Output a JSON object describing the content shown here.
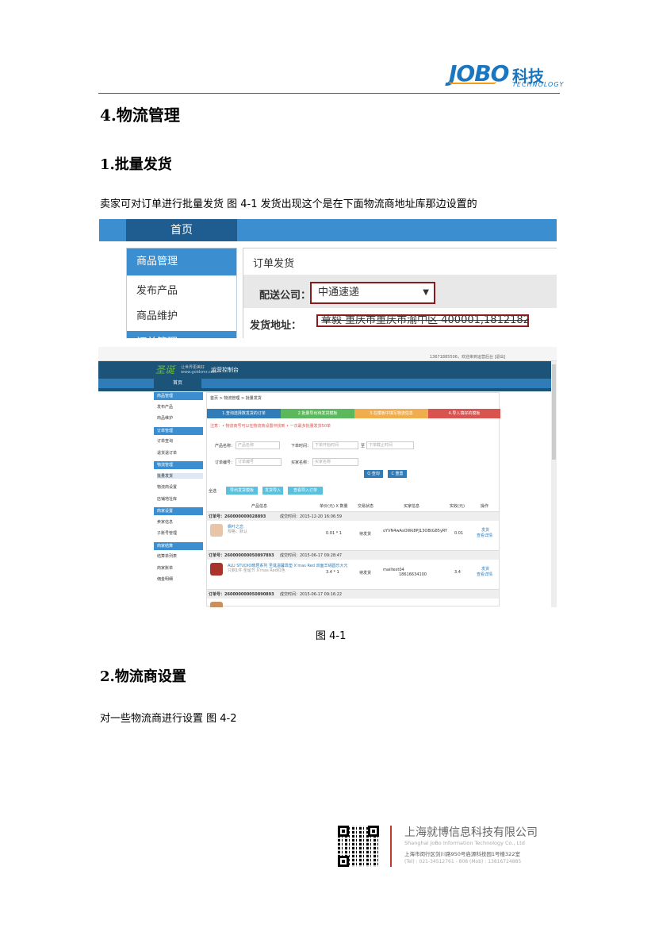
{
  "header": {
    "logo_text": "JOBO",
    "logo_cn": "科技",
    "logo_en": "TECHNOLOGY"
  },
  "section": {
    "heading": "4.物流管理",
    "sub1": "1.批量发货",
    "para1": "卖家可对订单进行批量发货  图 4-1 发货出现这个是在下面物流商地址库那边设置的",
    "caption": "图 4-1",
    "sub2": "2.物流商设置",
    "para2": "对一些物流商进行设置  图  4-2"
  },
  "shot1": {
    "home": "首页",
    "side_head": "商品管理",
    "side_items": [
      "发布产品",
      "商品维护"
    ],
    "side_head2": "订单管理",
    "panel_title": "订单发货",
    "carrier_label": "配送公司：",
    "carrier_value": "中通速递",
    "address_label": "发货地址：",
    "address_value": "章毅 重庆市重庆市渝中区 400001,18121822010"
  },
  "shot2": {
    "topbar_text": "13671885506，欢迎来到运营后台  [退出]",
    "brand": "圣诞",
    "brand_sub1": "让世界更美好",
    "brand_sub2": "www.goldsmr.com",
    "console": "运营控制台",
    "nav_home": "首页",
    "breadcrumb": "首页 > 物流管理 > 批量发货",
    "sidebar": [
      {
        "t": "h",
        "label": "商品管理"
      },
      {
        "t": "i",
        "label": "发布产品"
      },
      {
        "t": "i",
        "label": "商品维护"
      },
      {
        "t": "h",
        "label": "订单管理"
      },
      {
        "t": "i",
        "label": "订单查询"
      },
      {
        "t": "i",
        "label": "退货退订单"
      },
      {
        "t": "h",
        "label": "物流管理"
      },
      {
        "t": "i",
        "label": "批量发货"
      },
      {
        "t": "i",
        "label": "物流商设置"
      },
      {
        "t": "i",
        "label": "店铺地址库"
      },
      {
        "t": "h",
        "label": "商家设置"
      },
      {
        "t": "i",
        "label": "卖家信息"
      },
      {
        "t": "i",
        "label": "子账号管理"
      },
      {
        "t": "h",
        "label": "商家结算"
      },
      {
        "t": "i",
        "label": "结算单列表"
      },
      {
        "t": "i",
        "label": "商家账单"
      },
      {
        "t": "i",
        "label": "佣金明细"
      }
    ],
    "steps": [
      "1.查询选择数发货的订单",
      "2.批量导出待发货模板",
      "3.在模板中填写物流信息",
      "4.导入填好的模板"
    ],
    "step_colors": [
      "#2f7cb8",
      "#5cb85c",
      "#f0ad4e",
      "#d9534f"
    ],
    "notice": "注意：• 物流商号可以在物流商设置中找到 • 一次最多批量发货50单",
    "f_product": "产品名称：",
    "f_product_ph": "产品名称",
    "f_time": "下单时间：",
    "f_time_ph1": "下单开始时间",
    "f_to": "至",
    "f_time_ph2": "下单截止时间",
    "f_order": "订单编号：",
    "f_order_ph": "订单编号",
    "f_buyer": "买家名称：",
    "f_buyer_ph": "买家名称",
    "btn_search": "Q 查询",
    "btn_reset": "C 重置",
    "select_all": "全选",
    "btn1": "导出发货模板",
    "btn2": "发货导入",
    "btn3": "查看导入订单",
    "cols": [
      "产品信息",
      "单价(元) X 数量",
      "交易状态",
      "买家信息",
      "实收(元)",
      "操作"
    ],
    "orders": [
      {
        "no": "订单号：260000000028893",
        "time": "成交时间：2015-12-20 16:06:59",
        "title": "枫叶之恋",
        "sub": "规格：默认",
        "price": "0.01 * 1",
        "status": "待发货",
        "buyer1": "oYVN4wAsOWk8PJ13OBtG85yRY",
        "buyer2": "",
        "paid": "0.01",
        "op1": "发货",
        "op2": "查看详情",
        "color": "#e8c4a8"
      },
      {
        "no": "订单号：260000000050897893",
        "time": "成交时间：2015-06-17 09:28:47",
        "title": "ALU STUDIO暖居系列 圣诞温馨靠垫 X'mas Red 双面羊绒圆乐大元",
        "sub": "只剩1件 圣诞节 X'mas Red红色",
        "price": "3.4 * 1",
        "status": "待发货",
        "buyer1": "mailtest04",
        "buyer2": "18616634100",
        "paid": "3.4",
        "op1": "发货",
        "op2": "查看详情",
        "color": "#a8332a"
      },
      {
        "no": "订单号：260000000050890893",
        "time": "成交时间：2015-06-17 09:16:22",
        "title": "",
        "sub": "",
        "price": "",
        "status": "",
        "buyer1": "",
        "buyer2": "",
        "paid": "",
        "op1": "",
        "op2": "",
        "color": "#c89060"
      }
    ]
  },
  "footer": {
    "company_cn": "上海就博信息科技有限公司",
    "company_en": "Shanghai JoBo Information Technology Co., Ltd",
    "address": "上海市闵行区剑川路950号启源科技园1号楼322室",
    "tel": "(Tel) : 021-34512761 - 808         (Mob) : 13816724885"
  }
}
